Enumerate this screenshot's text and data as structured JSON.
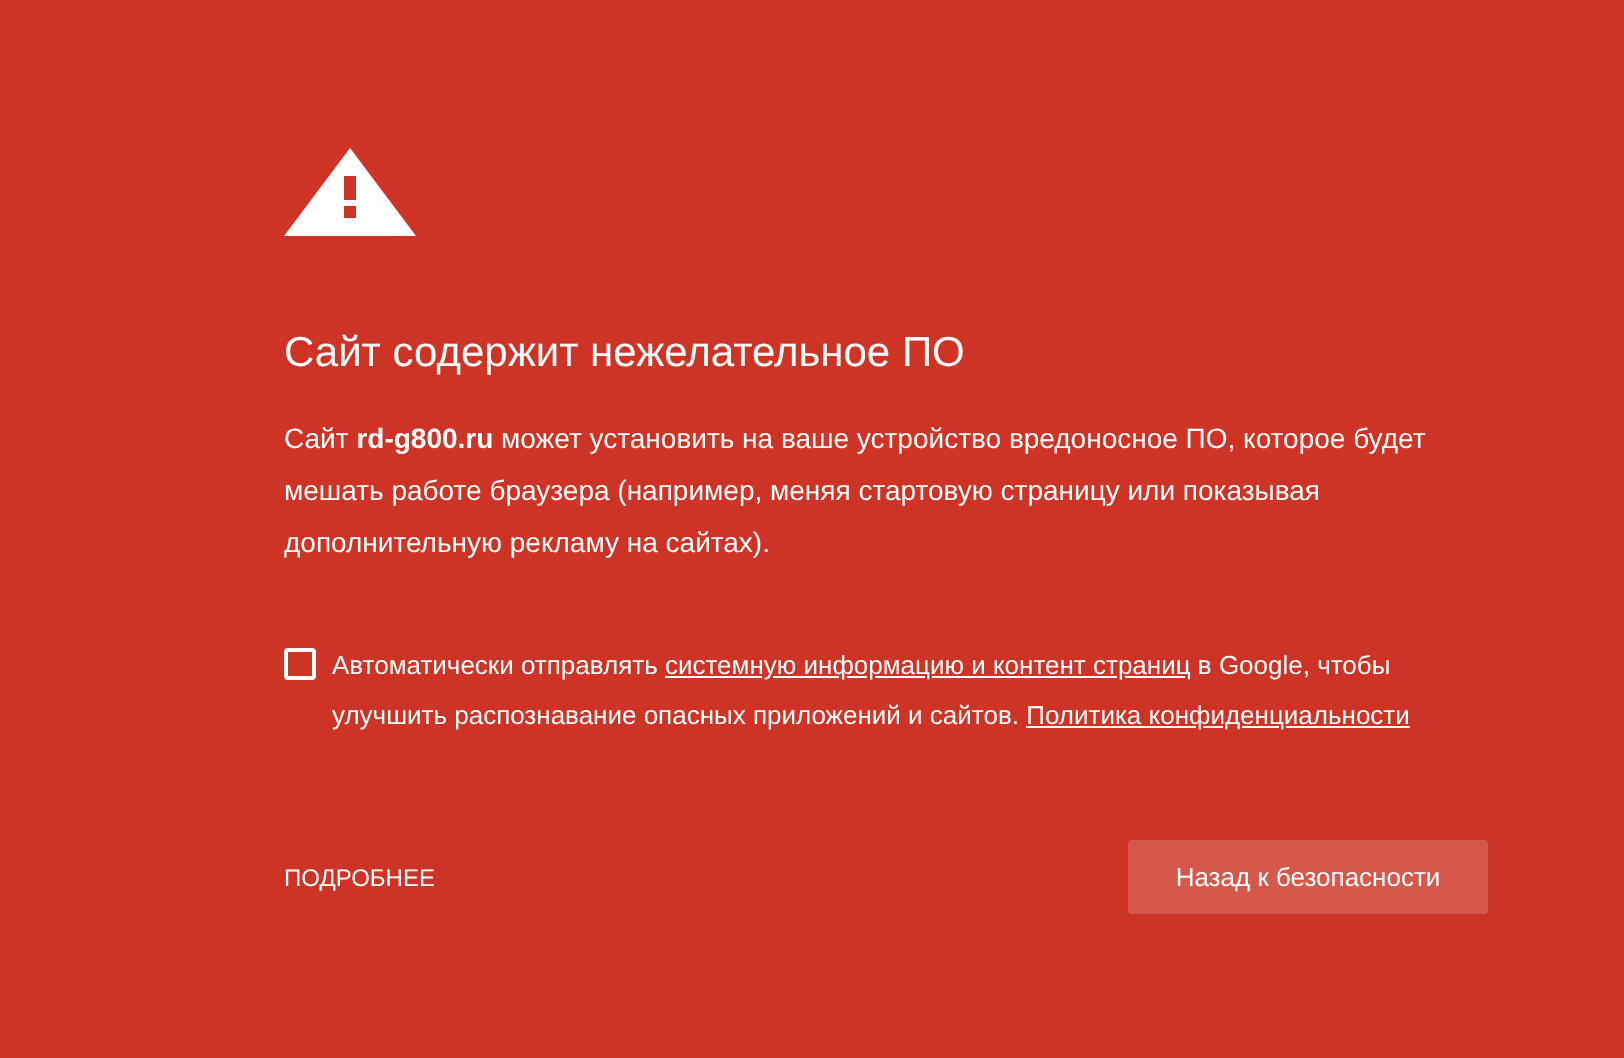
{
  "heading": "Сайт содержит нежелательное ПО",
  "description": "Сайт **rd-g800.ru** может установить на ваше устройство вредоносное ПО, которое будет мешать работе браузера (например, меняя стартовую страницу или показывая дополнительную рекламу на сайтах).",
  "report_option": {
    "checked": false,
    "text_before": "Автоматически отправлять",
    "link_1": "системную информацию и контент страниц",
    "text_middle": "в Google, чтобы улучшить распознавание опасных приложений и сайтов.",
    "link_2": "Политика конфиденциальности"
  },
  "details_link": "ПОДРОБНЕЕ",
  "back_button": "Назад к безопасности"
}
